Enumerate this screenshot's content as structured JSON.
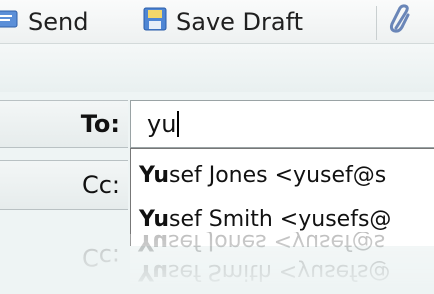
{
  "toolbar": {
    "send_label": "Send",
    "send_icon": "send-icon",
    "save_draft_label": "Save Draft",
    "save_draft_icon": "save-icon",
    "attach_icon": "paperclip-icon"
  },
  "compose": {
    "to_label": "To:",
    "to_value": "yu",
    "cc_label": "Cc:"
  },
  "autocomplete": {
    "items": [
      {
        "match": "Yu",
        "rest": "sef Jones <yusef@s"
      },
      {
        "match": "Yu",
        "rest": "sef Smith <yusefs@"
      }
    ]
  },
  "colors": {
    "background": "#e8f2f3",
    "accent_blue": "#3a7bd5"
  }
}
